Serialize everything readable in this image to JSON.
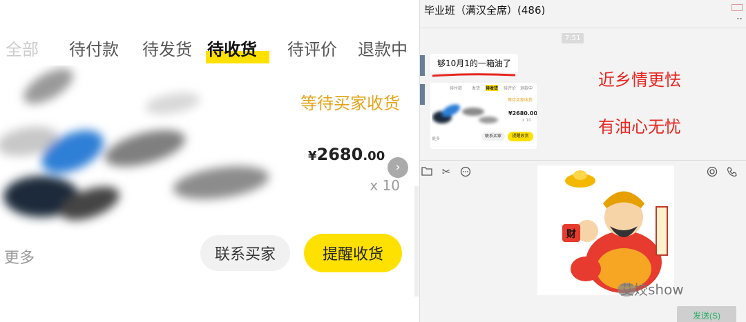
{
  "order": {
    "tabs": [
      "全部",
      "待付款",
      "待发货",
      "待收货",
      "待评价",
      "退款中"
    ],
    "active_tab_index": 3,
    "status": "等待买家收货",
    "price": {
      "currency": "¥",
      "integer": "2680",
      "cents": ".00"
    },
    "quantity": "x 10",
    "more_label": "更多",
    "contact_button": "联系买家",
    "remind_button": "提醒收货",
    "accent_color": "#ffe100",
    "status_color": "#e3a51b"
  },
  "chat": {
    "title": "毕业班（满汉全席）(486)",
    "header_dots": "..",
    "timestamp": "7:51",
    "message_text": "够10月1的一箱油了",
    "thumbnail": {
      "tabs": [
        "待付款",
        "发货",
        "待收货",
        "待评价",
        "退款中"
      ],
      "status": "等待买家收货",
      "price": "¥2680.00",
      "quantity": "x 10",
      "more": "更多",
      "contact": "联系买家",
      "remind": "提醒收货"
    },
    "caption1": "近乡情更怯",
    "caption2": "有油心无忧",
    "caption_color": "#e8251f",
    "toolbar_icons": [
      "folder-icon",
      "scissors-icon",
      "chat-bubble-icon",
      "target-icon",
      "phone-icon"
    ],
    "sticker_text": "财",
    "watermark": "艾姣show",
    "send_button": "发送(S)"
  }
}
